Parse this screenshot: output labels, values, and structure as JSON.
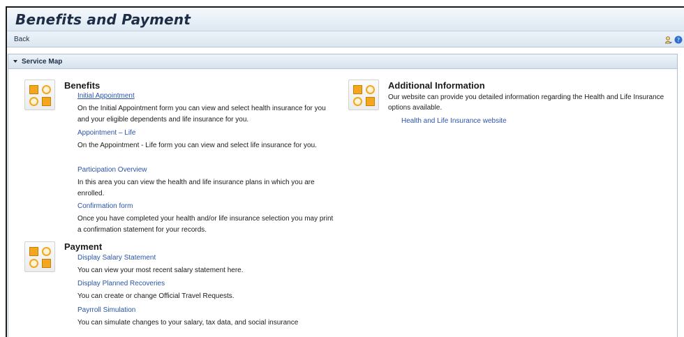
{
  "window": {
    "title": "Benefits and Payment"
  },
  "toolbar": {
    "back_label": "Back"
  },
  "service_map": {
    "title": "Service Map",
    "groups": {
      "benefits": {
        "title": "Benefits",
        "items": [
          {
            "link": "Initial Appointment",
            "desc": "On the Initial Appointment form you can view and select health insurance for you and your eligible dependents and life insurance for you."
          },
          {
            "link": "Appointment – Life",
            "desc": "On the Appointment - Life form you can view and select life insurance for you."
          },
          {
            "link": "Participation Overview",
            "desc": "In this area you can view the health and life insurance plans in which you are enrolled."
          },
          {
            "link": "Confirmation form",
            "desc": "Once you have completed your health and/or life insurance selection you may print a confirmation statement for your records."
          }
        ]
      },
      "payment": {
        "title": "Payment",
        "items": [
          {
            "link": "Display Salary Statement",
            "desc": "You can view your most recent salary statement here."
          },
          {
            "link": "Display Planned Recoveries",
            "desc": "You can create or change Official Travel Requests."
          },
          {
            "link": "Payrroll Simulation",
            "desc": "You can simulate changes to your salary, tax data, and social insurance"
          }
        ]
      },
      "additional": {
        "title": "Additional Information",
        "desc": "Our website can provide you detailed information regarding the Health and Life Insurance options available.",
        "link": "Health and Life Insurance website"
      }
    }
  },
  "icons": [
    "person-icon",
    "help-icon",
    "service-group-icon"
  ],
  "colors": {
    "accent": "#2a54a8",
    "icon_orange": "#f2a71e",
    "header_bg": "#dde8f2"
  }
}
